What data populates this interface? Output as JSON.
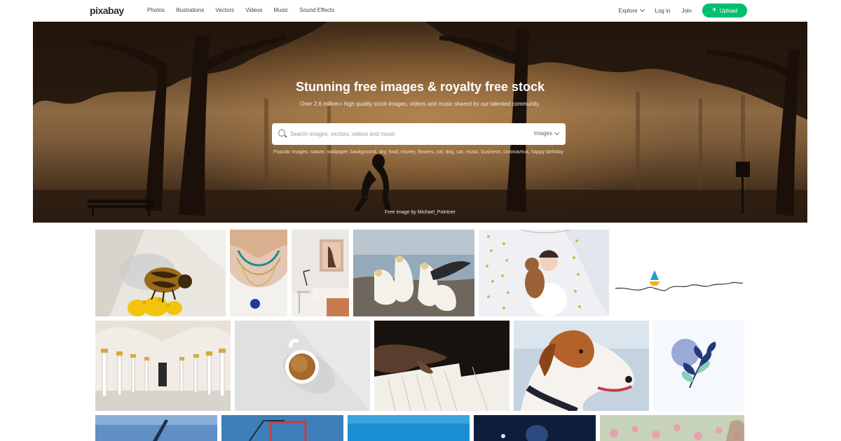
{
  "brand": {
    "logo_text": "pixabay"
  },
  "nav": {
    "items": [
      "Photos",
      "Illustrations",
      "Vectors",
      "Videos",
      "Music",
      "Sound Effects"
    ],
    "explore_label": "Explore",
    "login_label": "Log in",
    "join_label": "Join",
    "upload_label": "Upload"
  },
  "hero": {
    "title": "Stunning free images & royalty free stock",
    "subtitle": "Over 2.6 million+ high quality stock images, videos and music shared by our talented community.",
    "search_placeholder": "Search images, vectors, videos and music",
    "search_type": "Images",
    "popular_text": "Popular Images: nature, wallpaper, background, sky, food, money, flowers, cat, dog, car, music, business, coronavirus, happy birthday",
    "credit": "Free image by Michael_Pointner"
  },
  "gallery": {
    "tiles": [
      {
        "name": "bee-on-flower-image"
      },
      {
        "name": "necklaces-image"
      },
      {
        "name": "interior-bedroom-image"
      },
      {
        "name": "gannets-birds-image"
      },
      {
        "name": "girl-with-teddy-bear-image"
      },
      {
        "name": "boat-line-illustration-image"
      },
      {
        "name": "mosque-arches-image"
      },
      {
        "name": "coffee-cup-image"
      },
      {
        "name": "piano-hands-image"
      },
      {
        "name": "dog-portrait-image"
      },
      {
        "name": "leaf-illustration-image"
      },
      {
        "name": "crane-sky-image"
      },
      {
        "name": "harbor-cranes-image"
      },
      {
        "name": "blue-sky-image"
      },
      {
        "name": "dark-blue-image"
      },
      {
        "name": "pink-flowers-image"
      }
    ]
  }
}
